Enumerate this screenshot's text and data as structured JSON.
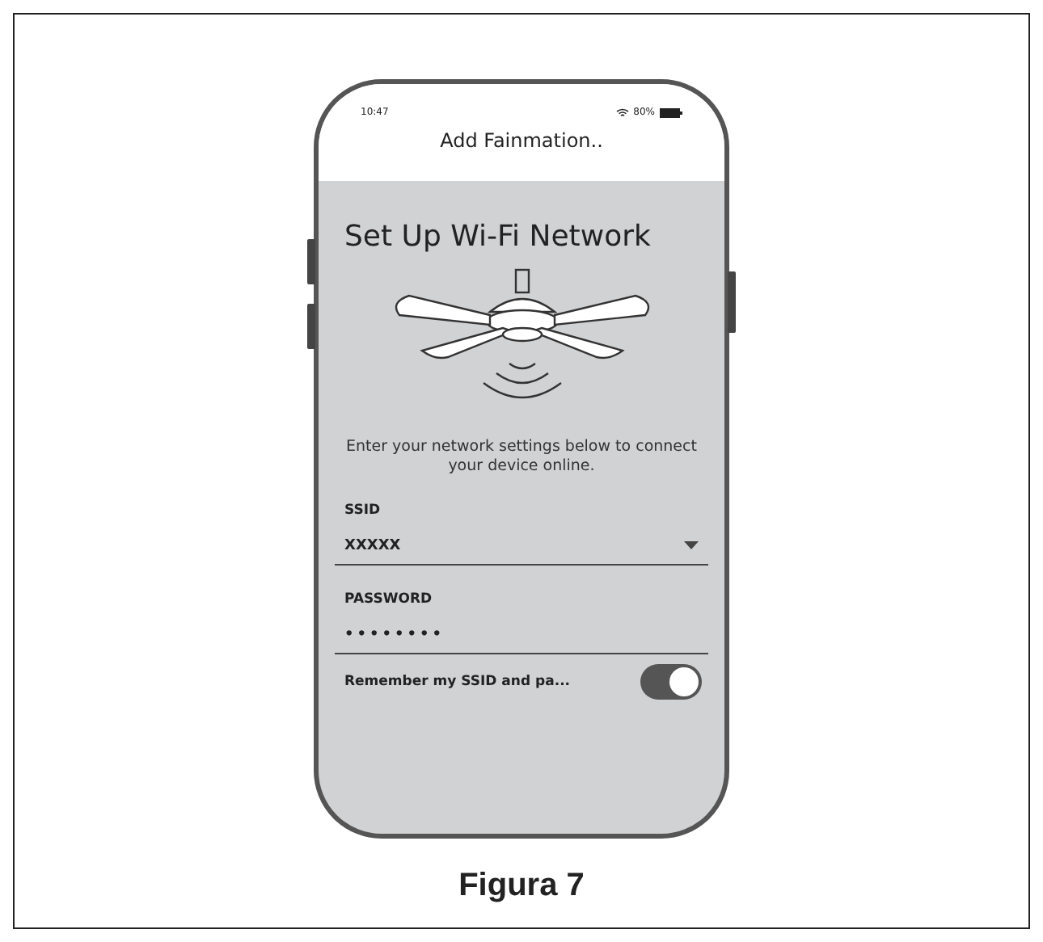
{
  "status_bar": {
    "time": "10:47",
    "battery": "80%"
  },
  "header": {
    "title": "Add Fainmation.."
  },
  "screen": {
    "title": "Set Up Wi-Fi Network",
    "instructions": "Enter your network settings below to connect your device online."
  },
  "fields": [
    {
      "kind": "dropdown",
      "label": "SSID",
      "value": "XXXXX"
    },
    {
      "kind": "password",
      "label": "PASSWORD",
      "value": "••••••••"
    }
  ],
  "remember": {
    "label": "Remember my SSID and pa...",
    "on": true
  },
  "caption": "Figura 7"
}
